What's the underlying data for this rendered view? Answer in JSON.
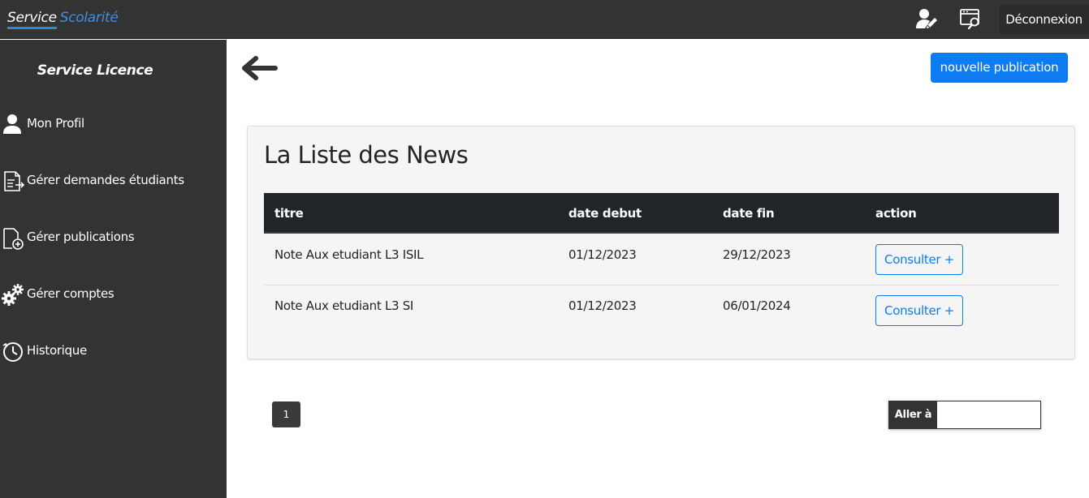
{
  "topbar": {
    "brand_part1": "Service",
    "brand_part2": "Scolarité",
    "icons": [
      "user-edit-icon",
      "browser-search-icon"
    ],
    "logout_label": "Déconnexion"
  },
  "sidebar": {
    "title": "Service Licence",
    "items": [
      {
        "label": "Mon Profil",
        "icon": "user-icon"
      },
      {
        "label": "Gérer demandes étudiants",
        "icon": "document-export-icon"
      },
      {
        "label": "Gérer publications",
        "icon": "document-add-icon"
      },
      {
        "label": "Gérer comptes",
        "icon": "gears-icon"
      },
      {
        "label": "Historique",
        "icon": "clock-history-icon"
      }
    ]
  },
  "main": {
    "new_button_label": "nouvelle publication",
    "card_title": "La Liste des News",
    "table": {
      "headers": [
        "titre",
        "date debut",
        "date fin",
        "action"
      ],
      "rows": [
        {
          "titre": "Note Aux etudiant L3 ISIL",
          "date_debut": "01/12/2023",
          "date_fin": "29/12/2023",
          "action": "Consulter +"
        },
        {
          "titre": "Note Aux etudiant L3 SI",
          "date_debut": "01/12/2023",
          "date_fin": "06/01/2024",
          "action": "Consulter +"
        }
      ]
    },
    "pagination": {
      "current_page": "1",
      "goto_label": "Aller à",
      "goto_value": ""
    }
  },
  "colors": {
    "dark_bg": "#333333",
    "primary": "#0d7cf2",
    "table_header": "#212529",
    "card_bg": "#f5f5f5"
  }
}
